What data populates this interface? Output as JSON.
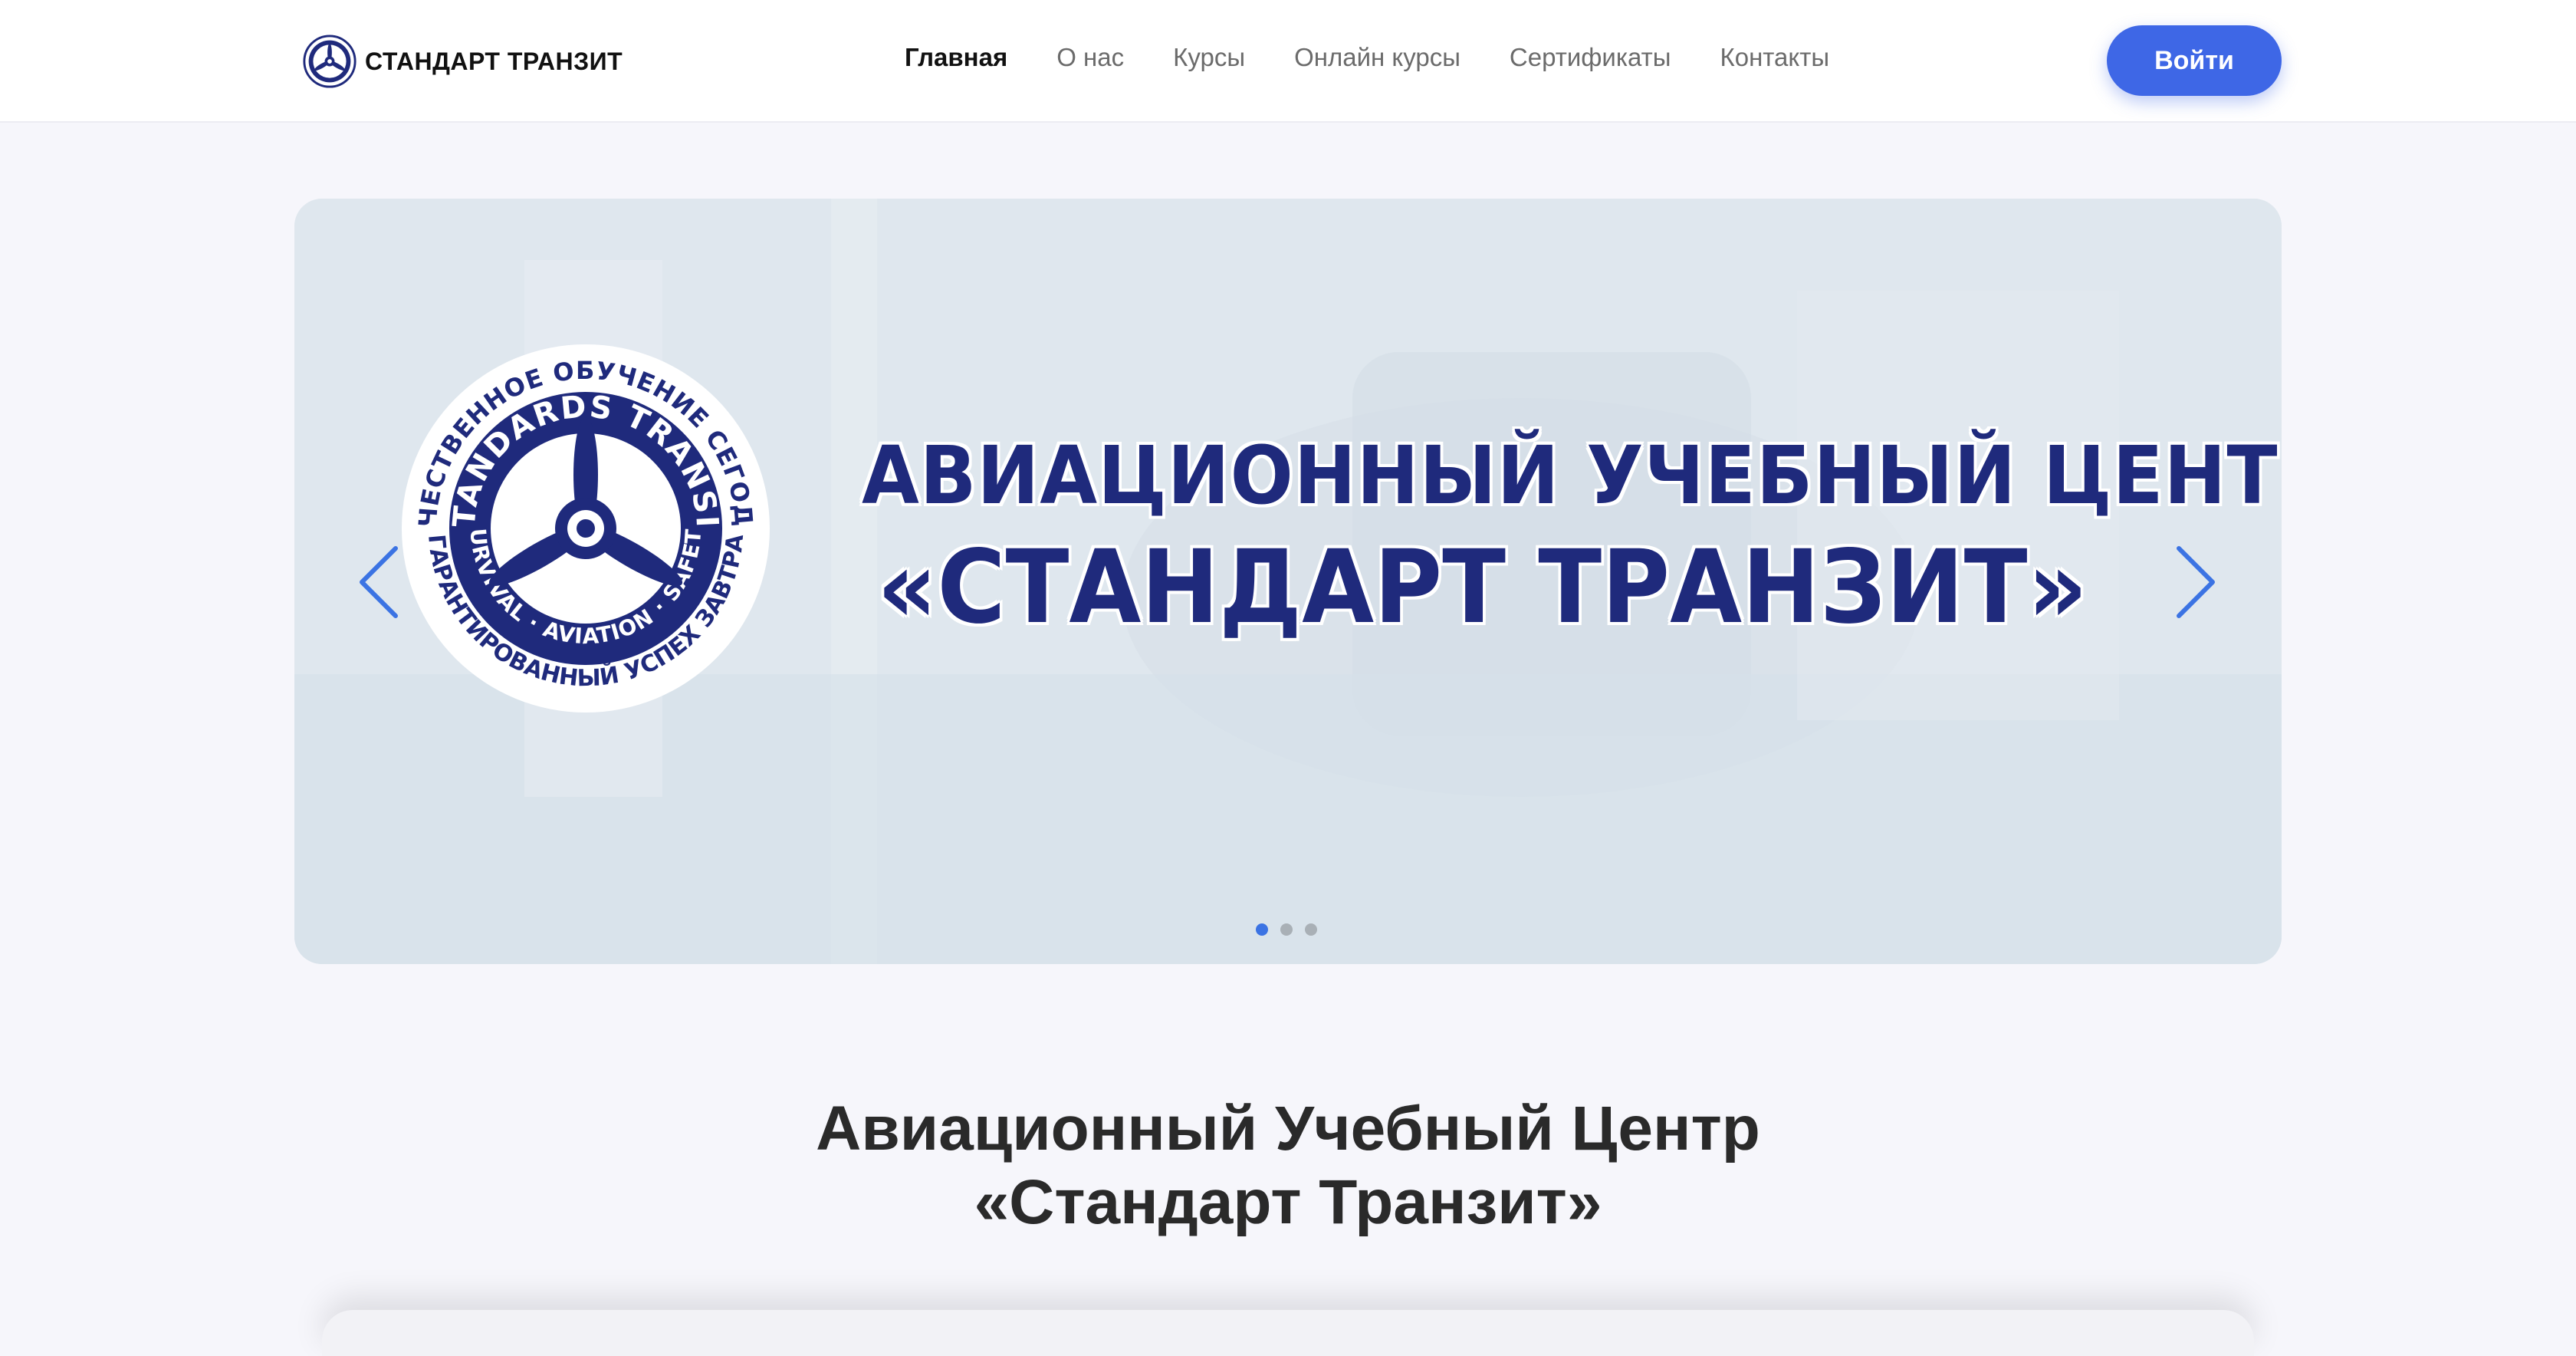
{
  "header": {
    "brand_name": "СТАНДАРТ ТРАНЗИТ",
    "nav": [
      {
        "label": "Главная",
        "active": true
      },
      {
        "label": "О нас"
      },
      {
        "label": "Курсы"
      },
      {
        "label": "Онлайн курсы"
      },
      {
        "label": "Сертификаты"
      },
      {
        "label": "Контакты"
      }
    ],
    "login_label": "Войти"
  },
  "slider": {
    "emblem": {
      "outer_top": "КАЧЕСТВЕННОЕ ОБУЧЕНИЕ СЕГОДНЯ",
      "inner_top": "STANDARDS TRANSIT",
      "inner_bottom": "SURVIVAL · AVIATION · SAFETY",
      "outer_bottom": "ГАРАНТИРОВАННЫЙ УСПЕХ ЗАВТРА"
    },
    "line1": "АВИАЦИОННЫЙ УЧЕБНЫЙ  ЦЕНТР",
    "line2": "«СТАНДАРТ ТРАНЗИТ»",
    "slide_count": 3,
    "active_slide": 1
  },
  "section": {
    "title_line1": "Авиационный Учебный Центр",
    "title_line2": "«Стандарт Транзит»"
  },
  "colors": {
    "accent": "#3e67e6",
    "brand_navy": "#1f2a7c",
    "dot_active": "#3b73e3"
  },
  "icons": {
    "prev": "chevron-left-icon",
    "next": "chevron-right-icon",
    "logo": "propeller-emblem-icon"
  }
}
